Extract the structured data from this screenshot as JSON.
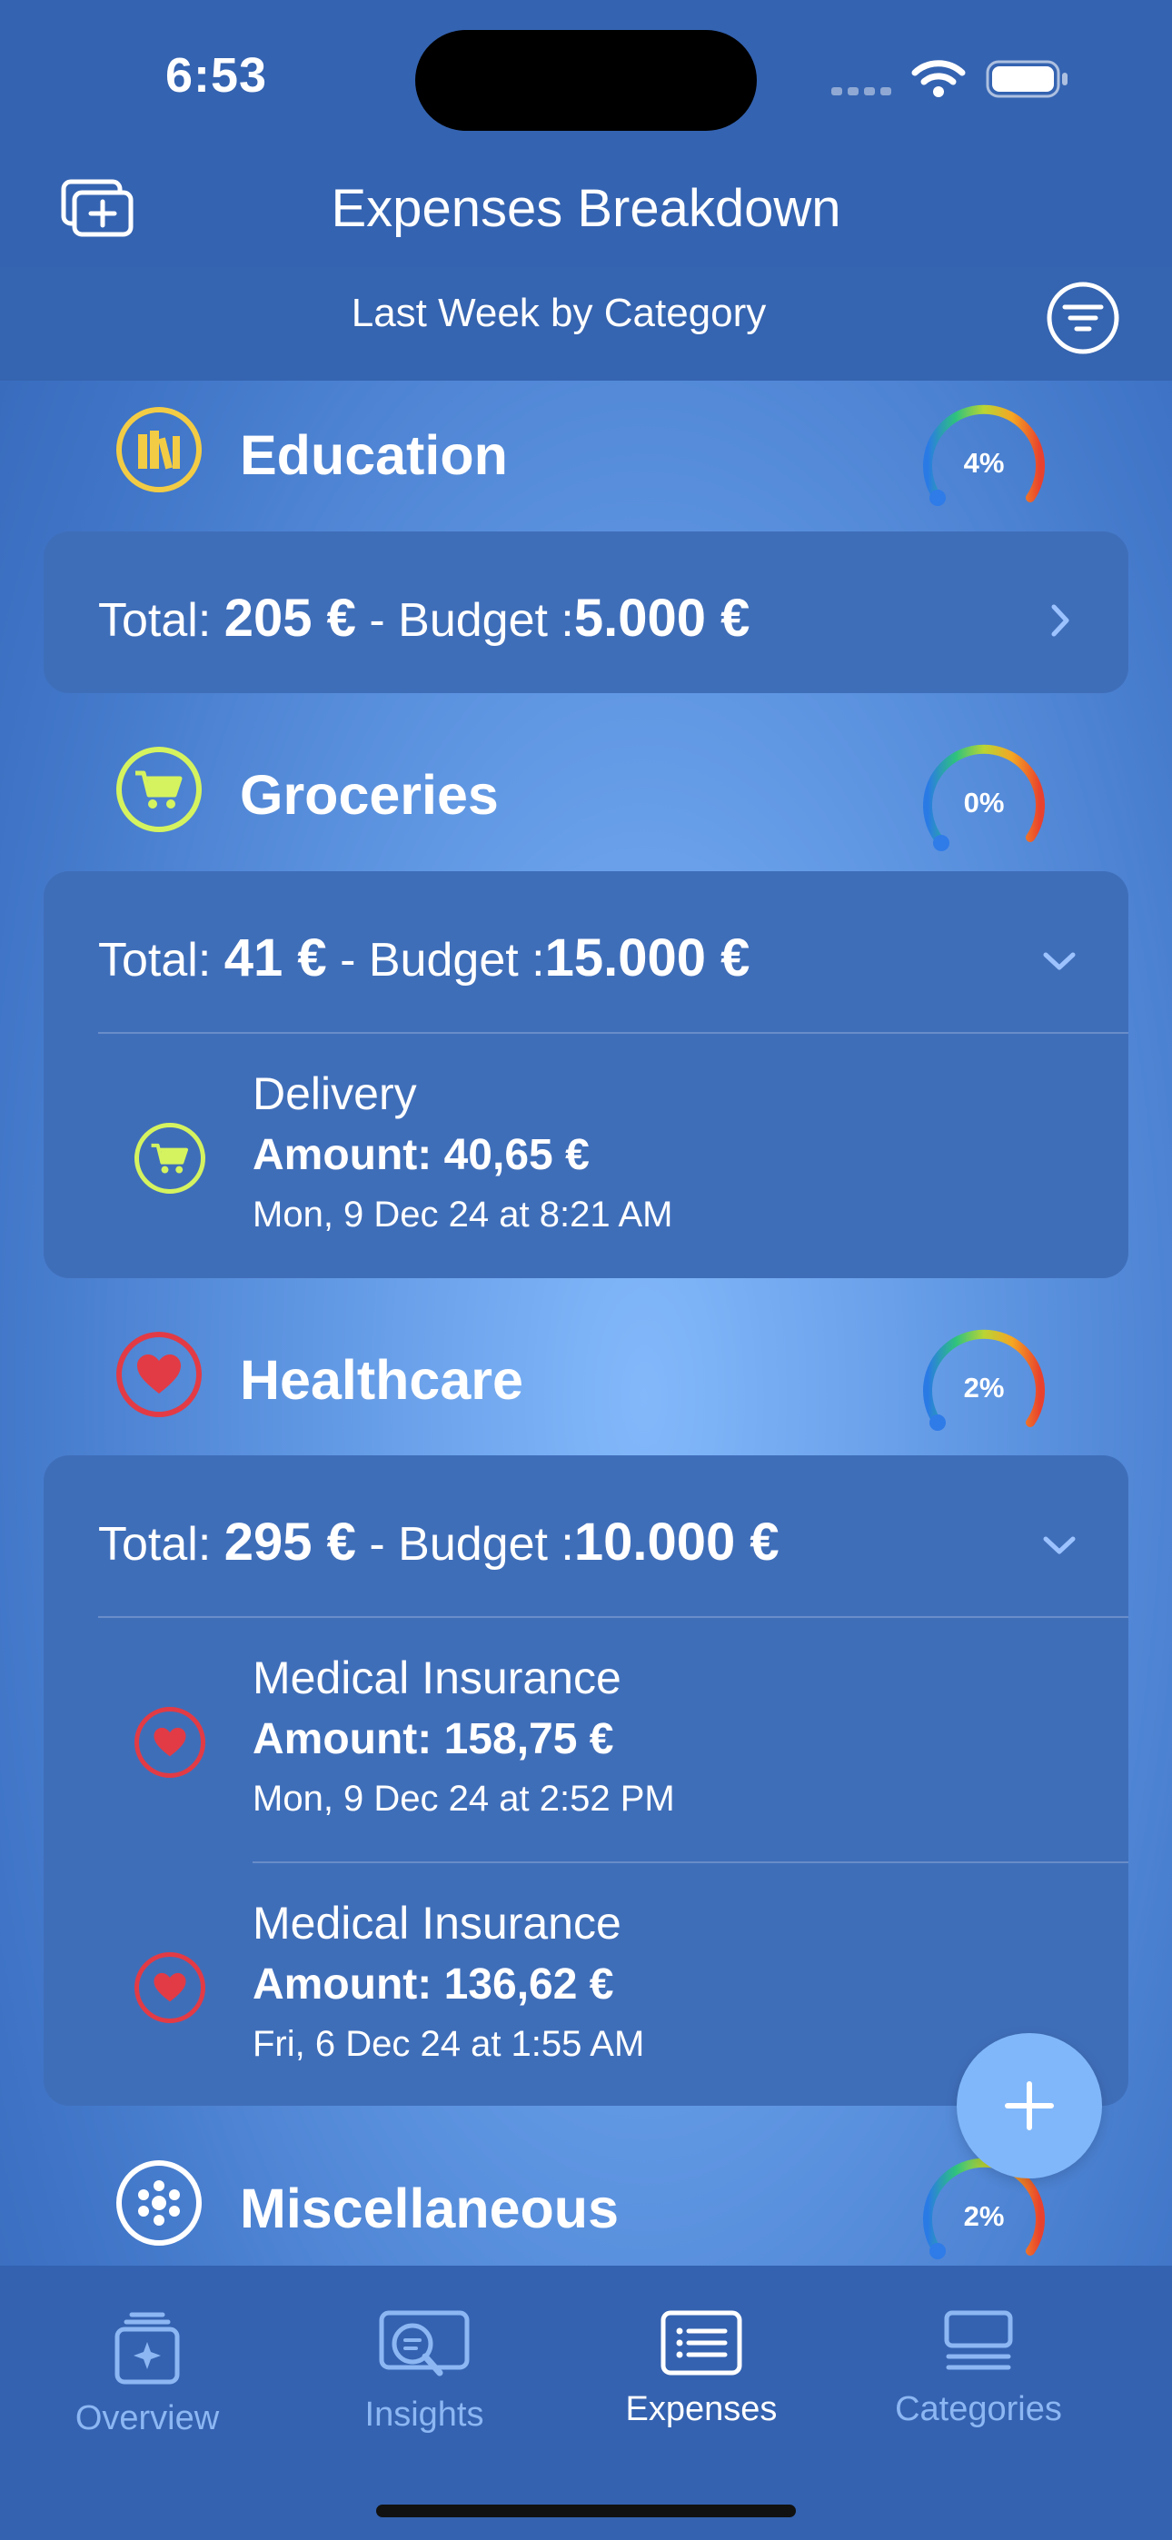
{
  "status_bar": {
    "time": "6:53"
  },
  "header": {
    "title": "Expenses Breakdown",
    "subtitle": "Last Week by Category"
  },
  "colors": {
    "education": "#f3cc45",
    "groceries": "#d5f35f",
    "healthcare": "#e23b45",
    "miscellaneous": "#ffffff",
    "background": "#3f74c6",
    "card": "#3f6eb9"
  },
  "categories": [
    {
      "name": "Education",
      "icon": "books-icon",
      "percent": "4%",
      "percent_value": 0.04,
      "total_label": "Total:",
      "total": "205 €",
      "separator": "-",
      "budget_label": "Budget :",
      "budget": "5.000 €",
      "expanded": false,
      "items": []
    },
    {
      "name": "Groceries",
      "icon": "cart-icon",
      "percent": "0%",
      "percent_value": 0.0,
      "total_label": "Total:",
      "total": "41 €",
      "separator": "-",
      "budget_label": "Budget :",
      "budget": "15.000 €",
      "expanded": true,
      "items": [
        {
          "name": "Delivery",
          "amount": "Amount: 40,65 €",
          "date": "Mon, 9 Dec 24 at 8:21 AM"
        }
      ]
    },
    {
      "name": "Healthcare",
      "icon": "heart-icon",
      "percent": "2%",
      "percent_value": 0.02,
      "total_label": "Total:",
      "total": "295 €",
      "separator": "-",
      "budget_label": "Budget :",
      "budget": "10.000 €",
      "expanded": true,
      "items": [
        {
          "name": "Medical Insurance",
          "amount": "Amount: 158,75 €",
          "date": "Mon, 9 Dec 24 at 2:52 PM"
        },
        {
          "name": "Medical Insurance",
          "amount": "Amount: 136,62 €",
          "date": "Fri, 6 Dec 24 at 1:55 AM"
        }
      ]
    },
    {
      "name": "Miscellaneous",
      "icon": "dots-circle-icon",
      "percent": "2%",
      "percent_value": 0.02
    }
  ],
  "tabs": [
    {
      "label": "Overview",
      "icon": "overview-icon",
      "active": false
    },
    {
      "label": "Insights",
      "icon": "insights-icon",
      "active": false
    },
    {
      "label": "Expenses",
      "icon": "expenses-list-icon",
      "active": true
    },
    {
      "label": "Categories",
      "icon": "categories-icon",
      "active": false
    }
  ]
}
